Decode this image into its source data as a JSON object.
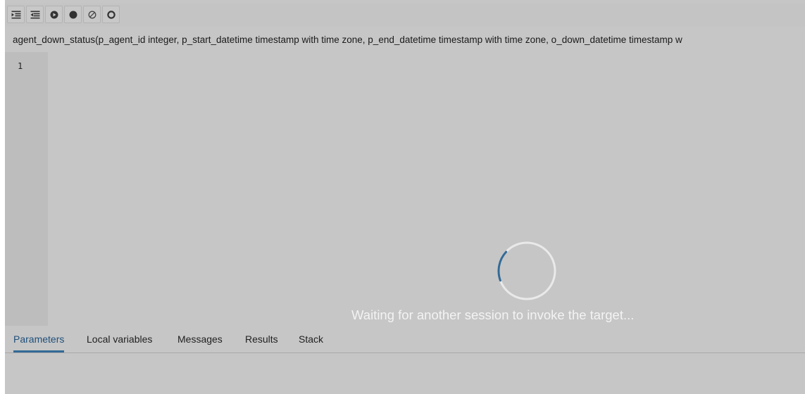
{
  "toolbar": {
    "buttons": [
      {
        "name": "step-into-button",
        "icon": "step-into-icon"
      },
      {
        "name": "step-over-button",
        "icon": "step-over-icon"
      },
      {
        "name": "continue-button",
        "icon": "continue-icon"
      },
      {
        "name": "toggle-breakpoint-button",
        "icon": "breakpoint-dot-icon"
      },
      {
        "name": "clear-breakpoints-button",
        "icon": "clear-icon"
      },
      {
        "name": "stop-button",
        "icon": "stop-icon"
      }
    ]
  },
  "signature": {
    "text": "agent_down_status(p_agent_id integer, p_start_datetime timestamp with time zone, p_end_datetime timestamp with time zone, o_down_datetime timestamp w"
  },
  "editor": {
    "line_numbers": [
      "1"
    ]
  },
  "overlay": {
    "message": "Waiting for another session to invoke the target..."
  },
  "tabs": [
    {
      "label": "Parameters",
      "active": true
    },
    {
      "label": "Local variables",
      "active": false
    },
    {
      "label": "Messages",
      "active": false
    },
    {
      "label": "Results",
      "active": false
    },
    {
      "label": "Stack",
      "active": false
    }
  ],
  "colors": {
    "background": "#c6c6c6",
    "accent": "#336a96",
    "spinner_track": "#e9e9e9",
    "overlay_text": "#f3f3f3"
  }
}
